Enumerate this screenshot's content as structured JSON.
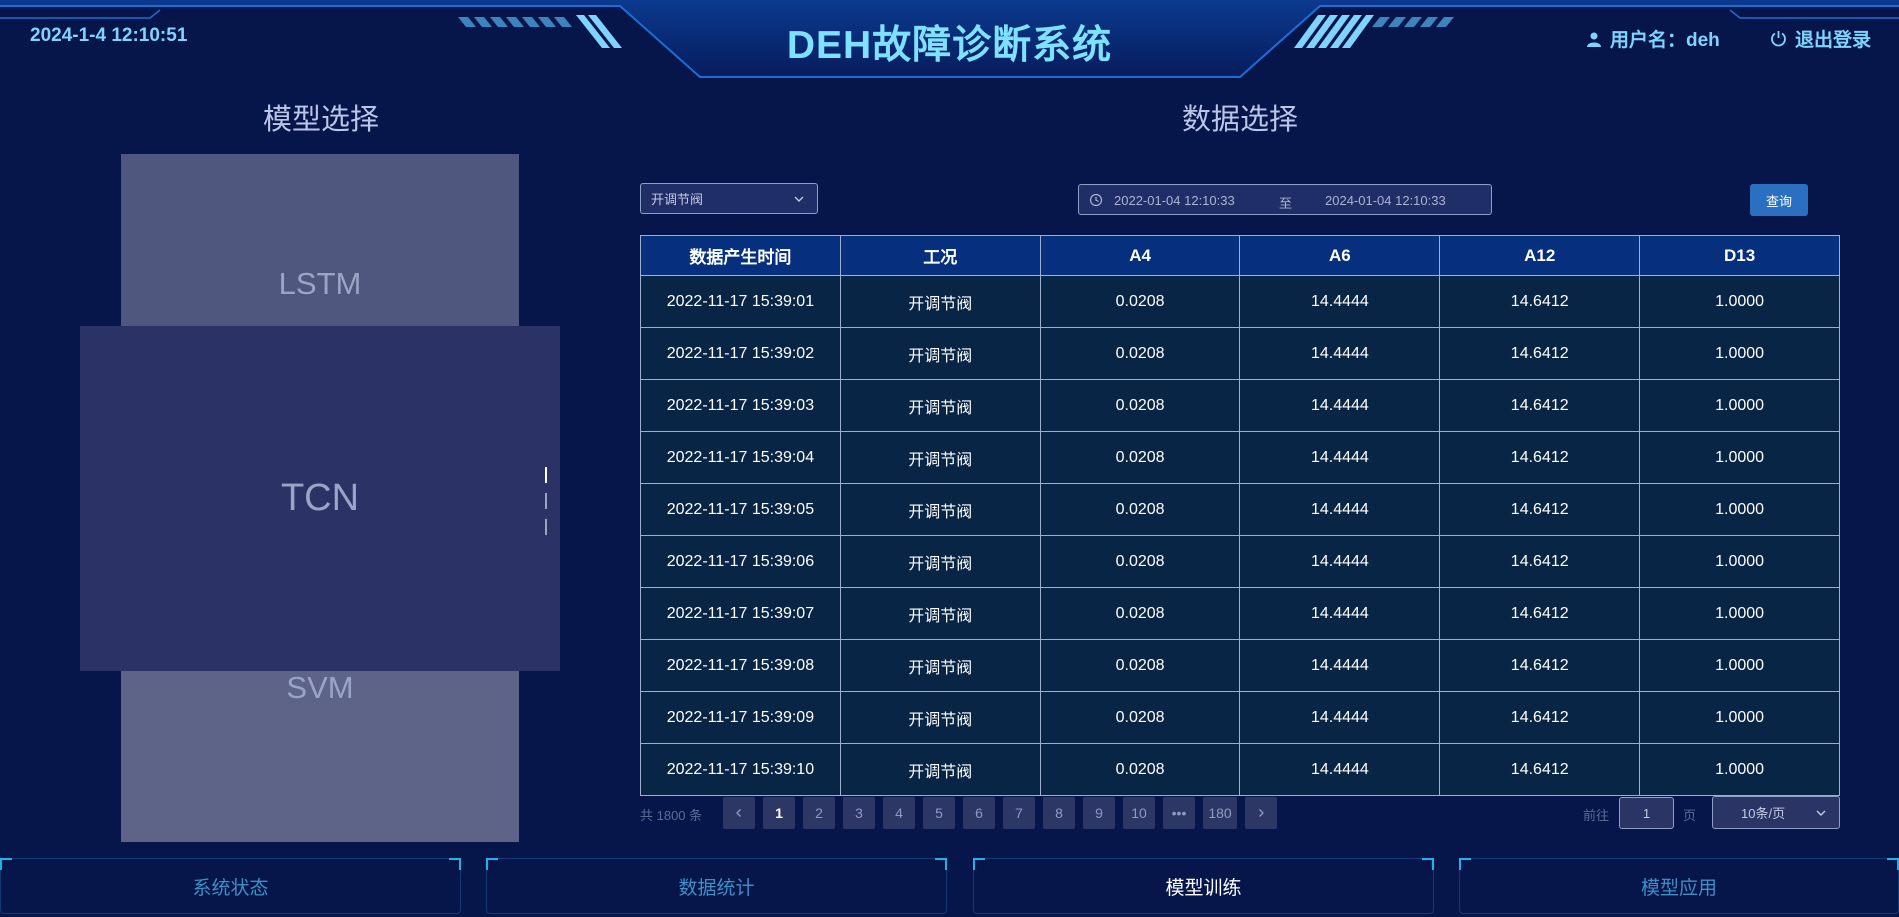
{
  "header": {
    "datetime": "2024-1-4 12:10:51",
    "title": "DEH故障诊断系统",
    "user_label": "用户名：deh",
    "logout_label": "退出登录",
    "accent_color": "#7fd4ff"
  },
  "model_panel": {
    "title": "模型选择",
    "models": [
      "LSTM",
      "TCN",
      "SVM"
    ],
    "selected": "TCN"
  },
  "data_panel": {
    "title": "数据选择",
    "condition_select": "开调节阀",
    "date_start": "2022-01-04 12:10:33",
    "date_separator": "至",
    "date_end": "2024-01-04 12:10:33",
    "query_label": "查询"
  },
  "table": {
    "columns": [
      "数据产生时间",
      "工况",
      "A4",
      "A6",
      "A12",
      "D13"
    ],
    "rows": [
      [
        "2022-11-17 15:39:01",
        "开调节阀",
        "0.0208",
        "14.4444",
        "14.6412",
        "1.0000"
      ],
      [
        "2022-11-17 15:39:02",
        "开调节阀",
        "0.0208",
        "14.4444",
        "14.6412",
        "1.0000"
      ],
      [
        "2022-11-17 15:39:03",
        "开调节阀",
        "0.0208",
        "14.4444",
        "14.6412",
        "1.0000"
      ],
      [
        "2022-11-17 15:39:04",
        "开调节阀",
        "0.0208",
        "14.4444",
        "14.6412",
        "1.0000"
      ],
      [
        "2022-11-17 15:39:05",
        "开调节阀",
        "0.0208",
        "14.4444",
        "14.6412",
        "1.0000"
      ],
      [
        "2022-11-17 15:39:06",
        "开调节阀",
        "0.0208",
        "14.4444",
        "14.6412",
        "1.0000"
      ],
      [
        "2022-11-17 15:39:07",
        "开调节阀",
        "0.0208",
        "14.4444",
        "14.6412",
        "1.0000"
      ],
      [
        "2022-11-17 15:39:08",
        "开调节阀",
        "0.0208",
        "14.4444",
        "14.6412",
        "1.0000"
      ],
      [
        "2022-11-17 15:39:09",
        "开调节阀",
        "0.0208",
        "14.4444",
        "14.6412",
        "1.0000"
      ],
      [
        "2022-11-17 15:39:10",
        "开调节阀",
        "0.0208",
        "14.4444",
        "14.6412",
        "1.0000"
      ]
    ]
  },
  "pagination": {
    "total_label": "共 1800 条",
    "prev_icon": "chevron-left-icon",
    "pages": [
      "1",
      "2",
      "3",
      "4",
      "5",
      "6",
      "7",
      "8",
      "9",
      "10",
      "•••",
      "180"
    ],
    "current_page": "1",
    "next_icon": "chevron-right-icon",
    "goto_label": "前往",
    "goto_value": "1",
    "page_suffix": "页",
    "page_size": "10条/页"
  },
  "nav": {
    "tabs": [
      "系统状态",
      "数据统计",
      "模型训练",
      "模型应用"
    ],
    "active": "模型训练"
  }
}
